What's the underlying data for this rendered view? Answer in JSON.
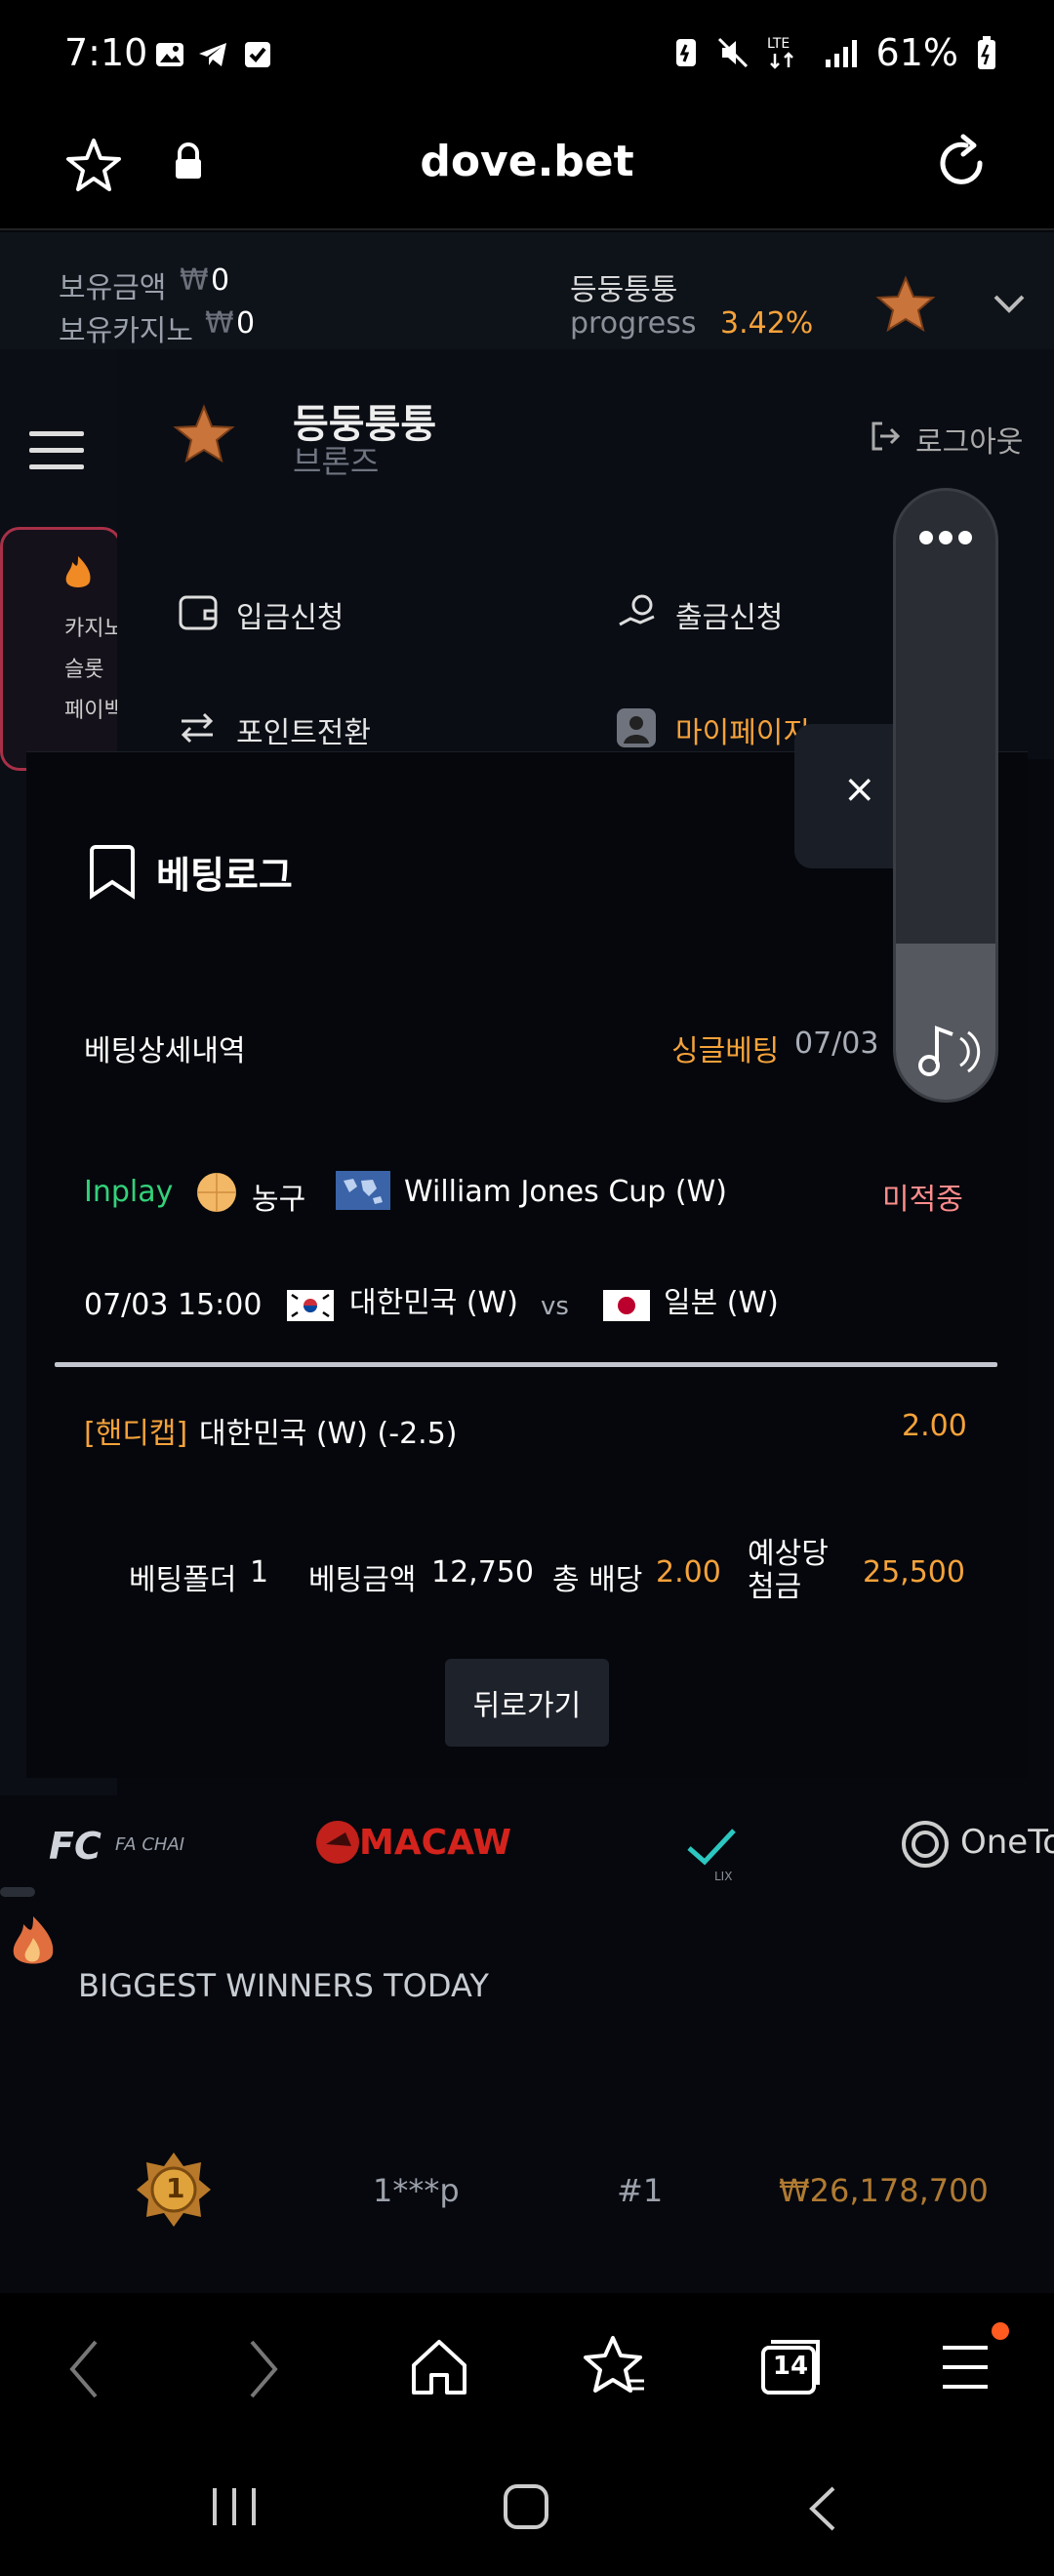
{
  "status_bar": {
    "time": "7:10",
    "battery": "61%"
  },
  "browser": {
    "url": "dove.bet"
  },
  "wallet": {
    "balance_label": "보유금액",
    "balance_currency": "₩",
    "balance_value": "0",
    "casino_label": "보유카지노",
    "casino_currency": "₩",
    "casino_value": "0",
    "user_name": "등둥퉁퉁",
    "progress_label": "progress",
    "progress_value": "3.42%"
  },
  "side_menu": {
    "user_name": "등둥퉁퉁",
    "rank": "브론즈",
    "logout_label": "로그아웃",
    "deposit_label": "입금신청",
    "withdraw_label": "출금신청",
    "points_label": "포인트전환",
    "mypage_label": "마이페이지"
  },
  "left_partial": {
    "casino": "카지노",
    "slot": "슬롯",
    "pay": "페이백"
  },
  "modal": {
    "title": "베팅로그",
    "close_label": "×",
    "detail_label": "베팅상세내역",
    "bet_type": "싱글베팅",
    "bet_date": "07/03",
    "inplay_label": "Inplay",
    "sport": "농구",
    "league": "William Jones Cup (W)",
    "status": "미적중",
    "match_time": "07/03 15:00",
    "home_team": "대한민국 (W)",
    "vs": "vs",
    "away_team": "일본 (W)",
    "market_tag": "[핸디캡]",
    "selection": "대한민국 (W) (-2.5)",
    "odds": "2.00",
    "folder_label": "베팅폴더",
    "folder_value": "1",
    "amount_label": "베팅금액",
    "amount_value": "12,750",
    "total_odds_label": "총 배당",
    "total_odds_value": "2.00",
    "expected_label_1": "예상당",
    "expected_label_2": "첨금",
    "expected_value": "25,500",
    "back_label": "뒤로가기"
  },
  "providers": {
    "p1": "FA CHAI",
    "p2": "MACAW",
    "p3": "LIX",
    "p4": "OneTo"
  },
  "winners": {
    "title": "BIGGEST WINNERS TODAY",
    "row": {
      "medal": "1",
      "user": "1***p",
      "rank": "#1",
      "amount": "₩26,178,700"
    }
  },
  "nav_bar": {
    "tabs_count": "14"
  },
  "colors": {
    "accent_orange": "#f5a23a",
    "inplay_green": "#33d17a",
    "lose_pink": "#ff8c8c"
  }
}
